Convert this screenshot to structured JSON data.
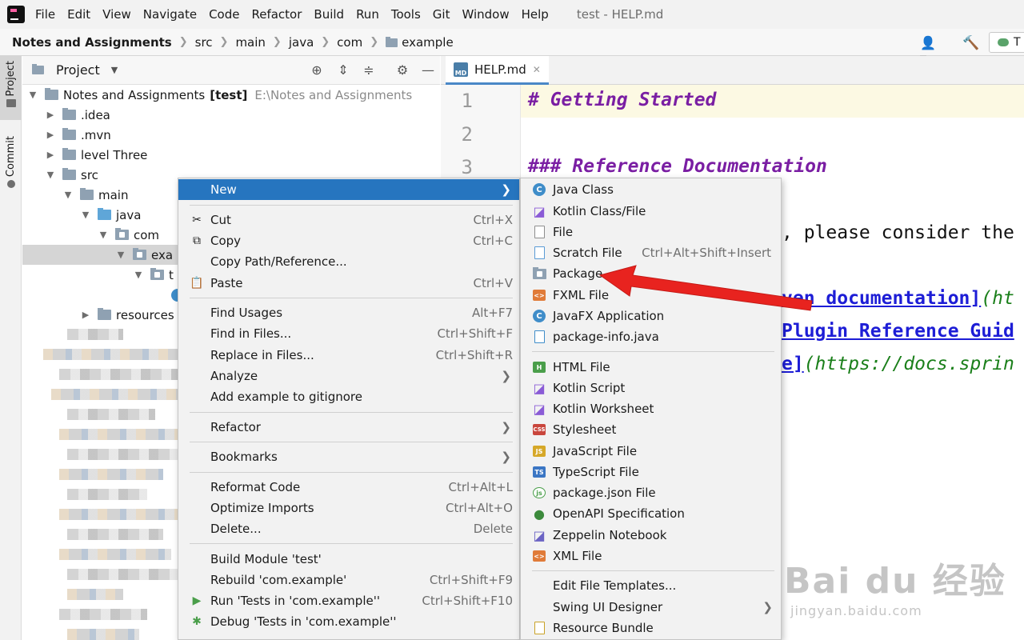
{
  "menubar": {
    "items": [
      "File",
      "Edit",
      "View",
      "Navigate",
      "Code",
      "Refactor",
      "Build",
      "Run",
      "Tools",
      "Git",
      "Window",
      "Help"
    ],
    "window_title": "test - HELP.md"
  },
  "navbar": {
    "crumbs": [
      "Notes and Assignments",
      "src",
      "main",
      "java",
      "com",
      "example"
    ],
    "run_config_label": "T"
  },
  "left_strip": {
    "project_label": "Project",
    "commit_label": "Commit"
  },
  "project_panel": {
    "title": "Project",
    "tree": {
      "root_label": "Notes and Assignments",
      "root_module": "[test]",
      "root_path": "E:\\Notes and Assignments",
      "idea": ".idea",
      "mvn": ".mvn",
      "level_three": "level Three",
      "src": "src",
      "main": "main",
      "java": "java",
      "com": "com",
      "example_partial": "exa",
      "test_partial": "t",
      "resources": "resources"
    }
  },
  "editor": {
    "tab_label": "HELP.md",
    "line_numbers": [
      "1",
      "2",
      "3"
    ],
    "lines": {
      "l1": "# Getting Started",
      "l3": "### Reference Documentation",
      "l5": ", please consider the",
      "l7_link": "ven documentation]",
      "l7_url": "(ht",
      "l8_link": "Plugin Reference Guid",
      "l9_link": "e]",
      "l9_url": "(https://docs.sprin"
    }
  },
  "context_menu": {
    "new": "New",
    "cut": "Cut",
    "cut_sc": "Ctrl+X",
    "copy": "Copy",
    "copy_sc": "Ctrl+C",
    "copy_path": "Copy Path/Reference...",
    "paste": "Paste",
    "paste_sc": "Ctrl+V",
    "find_usages": "Find Usages",
    "find_usages_sc": "Alt+F7",
    "find_in_files": "Find in Files...",
    "find_in_files_sc": "Ctrl+Shift+F",
    "replace_in_files": "Replace in Files...",
    "replace_in_files_sc": "Ctrl+Shift+R",
    "analyze": "Analyze",
    "add_gitignore": "Add example to gitignore",
    "refactor": "Refactor",
    "bookmarks": "Bookmarks",
    "reformat": "Reformat Code",
    "reformat_sc": "Ctrl+Alt+L",
    "optimize": "Optimize Imports",
    "optimize_sc": "Ctrl+Alt+O",
    "delete": "Delete...",
    "delete_sc": "Delete",
    "build_module": "Build Module 'test'",
    "rebuild": "Rebuild 'com.example'",
    "rebuild_sc": "Ctrl+Shift+F9",
    "run_tests": "Run 'Tests in 'com.example''",
    "run_tests_sc": "Ctrl+Shift+F10",
    "debug_tests": "Debug 'Tests in 'com.example''"
  },
  "new_submenu": {
    "java_class": "Java Class",
    "kotlin_class": "Kotlin Class/File",
    "file": "File",
    "scratch": "Scratch File",
    "scratch_sc": "Ctrl+Alt+Shift+Insert",
    "package": "Package",
    "fxml": "FXML File",
    "javafx": "JavaFX Application",
    "package_info": "package-info.java",
    "html": "HTML File",
    "kotlin_script": "Kotlin Script",
    "kotlin_worksheet": "Kotlin Worksheet",
    "stylesheet": "Stylesheet",
    "javascript": "JavaScript File",
    "typescript": "TypeScript File",
    "package_json": "package.json File",
    "openapi": "OpenAPI Specification",
    "zeppelin": "Zeppelin Notebook",
    "xml": "XML File",
    "edit_templates": "Edit File Templates...",
    "swing": "Swing UI Designer",
    "resource_bundle": "Resource Bundle"
  },
  "icon_tags": {
    "md": "MD",
    "css": "CSS",
    "js": "JS",
    "ts": "TS",
    "java_c": "C",
    "xml": "<>",
    "js_node": "js",
    "html": "H"
  },
  "colors": {
    "selection": "#2675bf",
    "arrow": "#e8231f",
    "accent_tab": "#4a88c7"
  },
  "watermark": {
    "brand": "Bai du 经验",
    "url": "jingyan.baidu.com"
  }
}
